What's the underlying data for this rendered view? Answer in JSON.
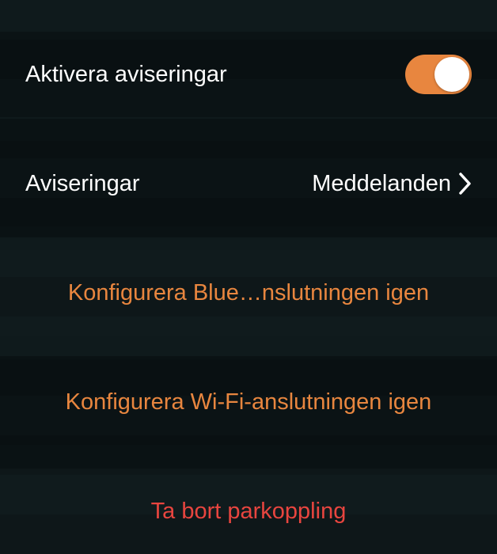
{
  "rows": {
    "enable_notifications": {
      "label": "Aktivera aviseringar",
      "toggle_on": true
    },
    "notifications": {
      "label": "Aviseringar",
      "value": "Meddelanden"
    }
  },
  "actions": {
    "reconfigure_bluetooth": "Konfigurera Blue…nslutningen igen",
    "reconfigure_wifi": "Konfigurera Wi-Fi-anslutningen igen",
    "unpair": "Ta bort parkoppling"
  },
  "colors": {
    "accent": "#e8863f",
    "destructive": "#e8453f"
  }
}
